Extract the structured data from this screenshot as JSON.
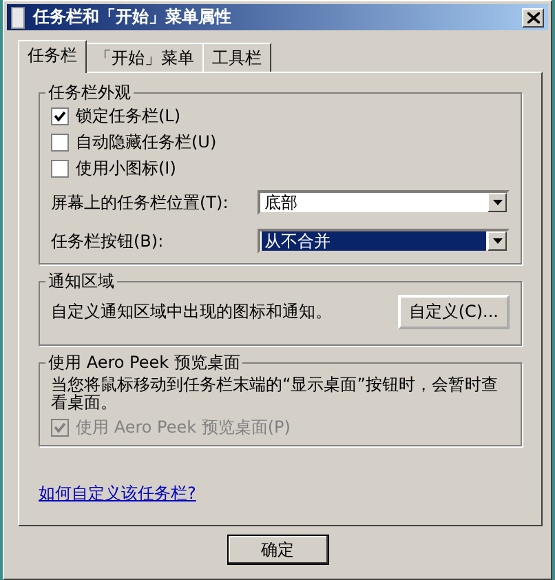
{
  "window": {
    "title": "任务栏和「开始」菜单属性"
  },
  "tabs": [
    {
      "label": "任务栏",
      "selected": true
    },
    {
      "label": "「开始」菜单",
      "selected": false
    },
    {
      "label": "工具栏",
      "selected": false
    }
  ],
  "groups": [
    {
      "title": "任务栏外观",
      "items": [
        {
          "kind": "checkbox",
          "label": "锁定任务栏(L)",
          "checked": true,
          "disabled": false
        },
        {
          "kind": "checkbox",
          "label": "自动隐藏任务栏(U)",
          "checked": false,
          "disabled": false
        },
        {
          "kind": "checkbox",
          "label": "使用小图标(I)",
          "checked": false,
          "disabled": false
        },
        {
          "kind": "dropdown",
          "label": "屏幕上的任务栏位置(T):",
          "value": "底部",
          "highlighted": false
        },
        {
          "kind": "dropdown",
          "label": "任务栏按钮(B):",
          "value": "从不合并",
          "highlighted": true
        }
      ]
    },
    {
      "title": "通知区域",
      "items": [
        {
          "kind": "text_button",
          "text": "自定义通知区域中出现的图标和通知。",
          "button": "自定义(C)..."
        }
      ]
    },
    {
      "title": "使用 Aero Peek 预览桌面",
      "items": [
        {
          "kind": "note",
          "text": "当您将鼠标移动到任务栏末端的“显示桌面”按钮时，会暂时查看桌面。"
        },
        {
          "kind": "checkbox",
          "label": "使用 Aero Peek 预览桌面(P)",
          "checked": true,
          "disabled": true
        }
      ]
    }
  ],
  "link": "如何自定义该任务栏?",
  "buttons": [
    "确定"
  ]
}
